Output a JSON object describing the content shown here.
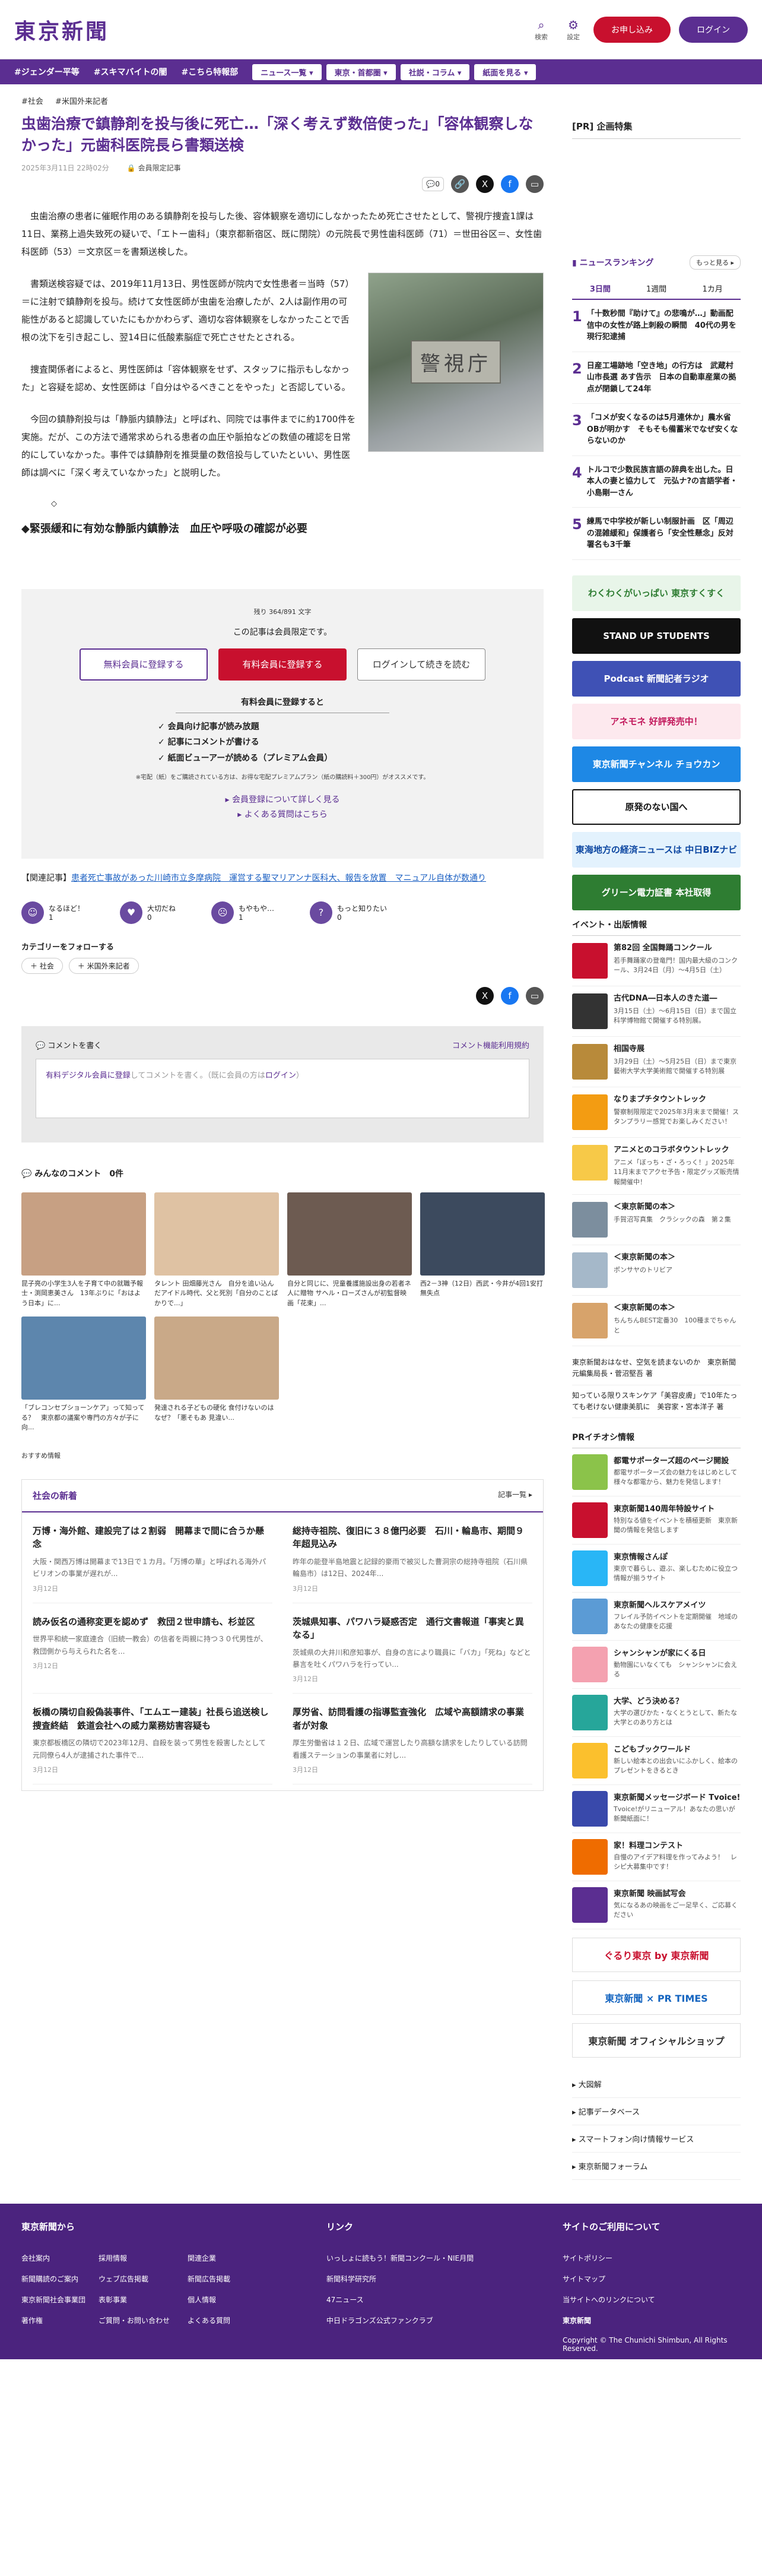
{
  "header": {
    "logo": "東京新聞",
    "search_label": "検索",
    "settings_label": "設定",
    "register_label": "お申し込み",
    "login_label": "ログイン"
  },
  "nav": {
    "hashtags": [
      "#ジェンダー平等",
      "#スキマバイトの闇",
      "#こちら特報部"
    ],
    "dropdowns": [
      "ニュース一覧",
      "東京・首都圏",
      "社説・コラム",
      "紙面を見る"
    ]
  },
  "article": {
    "tags": [
      "#社会",
      "#米国外来記者"
    ],
    "title": "虫歯治療で鎮静剤を投与後に死亡…「深く考えず数倍使った」「容体観察しなかった」元歯科医院長ら書類送検",
    "date": "2025年3月11日 22時02分",
    "member_only": "会員限定記事",
    "comment_count": "0",
    "paragraphs": [
      "虫歯治療の患者に催眠作用のある鎮静剤を投与した後、容体観察を適切にしなかったため死亡させたとして、警視庁捜査1課は11日、業務上過失致死の疑いで、「エトー歯科」（東京都新宿区、既に閉院）の元院長で男性歯科医師（71）＝世田谷区＝、女性歯科医師（53）＝文京区＝を書類送検した。",
      "書類送検容疑では、2019年11月13日、男性医師が院内で女性患者＝当時（57）＝に注射で鎮静剤を投与。続けて女性医師が虫歯を治療したが、2人は副作用の可能性があると認識していたにもかかわらず、適切な容体観察をしなかったことで舌根の沈下を引き起こし、翌14日に低酸素脳症で死亡させたとされる。",
      "捜査関係者によると、男性医師は「容体観察をせず、スタッフに指示もしなかった」と容疑を認め、女性医師は「自分はやるべきことをやった」と否認している。",
      "今回の鎮静剤投与は「静脈内鎮静法」と呼ばれ、同院では事件までに約1700件を実施。だが、この方法で通常求められる患者の血圧や脈拍などの数値の確認を日常的にしていなかった。事件では鎮静剤を推奨量の数倍投与していたといい、男性医師は調べに「深く考えていなかった」と説明した。"
    ],
    "image_sign": "警視庁",
    "diamond": "◇",
    "subheading": "◆緊張緩和に有効な静脈内鎮静法　血圧や呼吸の確認が必要"
  },
  "paywall": {
    "remaining": "残り 364/891 文字",
    "limit_text": "この記事は会員限定です。",
    "btn_free": "無料会員に登録する",
    "btn_paid": "有料会員に登録する",
    "btn_login": "ログインして続きを読む",
    "sub_heading": "有料会員に登録すると",
    "benefits": [
      "✓ 会員向け記事が読み放題",
      "✓ 記事にコメントが書ける",
      "✓ 紙面ビューアーが読める（プレミアム会員）"
    ],
    "note": "※宅配（紙）をご購読されている方は、お得な宅配プレミアムプラン（紙の購読料＋300円）がオススメです。",
    "link1": "▸ 会員登録について詳しく見る",
    "link2": "▸ よくある質問はこちら"
  },
  "related": {
    "label": "【関連記事】",
    "link": "患者死亡事故があった川崎市立多摩病院　運営する聖マリアンナ医科大、報告を放置　マニュアル自体が数通り"
  },
  "reactions": [
    {
      "label": "なるほど！",
      "count": "1"
    },
    {
      "label": "大切だね",
      "count": "0"
    },
    {
      "label": "もやもや…",
      "count": "1"
    },
    {
      "label": "もっと知りたい",
      "count": "0"
    }
  ],
  "follow": {
    "title": "カテゴリーをフォローする",
    "chips": [
      "＋ 社会",
      "＋ 米国外来記者"
    ]
  },
  "comment_box": {
    "title": "コメントを書く",
    "rules": "コメント機能利用規約",
    "placeholder_pre": "有料デジタル会員に登録",
    "placeholder_mid": "してコメントを書く。（既に会員の方は",
    "placeholder_login": "ログイン",
    "placeholder_post": "）"
  },
  "everyone_comments": {
    "title": "みんなのコメント",
    "count": "0件"
  },
  "thumbs": [
    {
      "caption": "昆子亮の小学生3人を子育て中の就職予報士・渕岡恵美さん　13年ぶりに「おはよう日本」に...",
      "color": "#c7a083"
    },
    {
      "caption": "タレント 田畑藤光さん　自分を追い込んだアイドル時代、父と死別「自分のことばかりで...」",
      "color": "#dfc2a3"
    },
    {
      "caption": "自分と同じに、児童養護施設出身の若者ネ人に贈物 サヘル・ローズさんが初監督映画「花束」...",
      "color": "#6d5b51"
    },
    {
      "caption": "西2－3神（12日）西武・今井が4回1安打無失点",
      "color": "#3c4a5e"
    },
    {
      "caption": "「ブレコンセプショーンケア」って知ってる？　東京都の議案や専門の方々が子に向...",
      "color": "#5d86ad"
    },
    {
      "caption": "発達される子どもの硬化 食付けないのはなぜ？「悪そもあ 見違い...",
      "color": "#c9a988"
    }
  ],
  "recommend_label": "おすすめ情報",
  "news_section": {
    "title": "社会の新着",
    "more": "記事一覧 ▸",
    "items": [
      {
        "title": "万博・海外館、建設完了は２割弱　開幕まで間に合うか懸念",
        "desc": "大阪・関西万博は開幕まで13日で１カ月。「万博の華」と呼ばれる海外パビリオンの事業が遅れが...",
        "date": "3月12日"
      },
      {
        "title": "総持寺祖院、復旧に３８億円必要　石川・輪島市、期間９年超見込み",
        "desc": "昨年の能登半島地震と記録的豪雨で被災した曹洞宗の総持寺祖院（石川県輪島市）は12日、2024年...",
        "date": "3月12日"
      },
      {
        "title": "読み仮名の通称変更を認めず　救団２世申請も、杉並区",
        "desc": "世界平和統一家庭連合（旧統一教会）の信者を両親に持つ３０代男性が、救団側から与えられた名を...",
        "date": "3月12日"
      },
      {
        "title": "茨城県知事、パワハラ疑惑否定　通行文書報道「事実と異なる」",
        "desc": "茨城県の大井川和彦知事が、自身の言により職員に「バカ」「死ね」などと暴言を吐くパワハラを行ってい...",
        "date": "3月12日"
      },
      {
        "title": "板橋の隣切自殺偽装事件、「エムエー建装」社長ら追送検し捜査終結　鉄道会社への威力業務妨害容疑も",
        "desc": "東京都板橋区の隣切で2023年12月、自殺を装って男性を殺害したとして元同僚ら4人が逮捕された事件で...",
        "date": "3月12日"
      },
      {
        "title": "厚労省、訪問看護の指導監査強化　広域や高額請求の事業者が対象",
        "desc": "厚生労働省は１２日、広域で運営したり高額な請求をしたりしている訪問看護ステーションの事業者に対し...",
        "date": "3月12日"
      }
    ]
  },
  "sidebar": {
    "pr_title": "[PR] 企画特集",
    "ranking_title": "ニュースランキング",
    "ranking_more": "もっと見る ▸",
    "ranking_tabs": [
      "3日間",
      "1週間",
      "1カ月"
    ],
    "ranking": [
      {
        "num": "1",
        "title": "「十数秒間『助けて』の悲鳴が…」動画配信中の女性が路上刺殺の瞬間　40代の男を現行犯逮捕"
      },
      {
        "num": "2",
        "title": "日産工場跡地「空き地」の行方は　武蔵村山市長選 あす告示　日本の自動車産業の拠点が閉鎖して24年"
      },
      {
        "num": "3",
        "title": "「コメが安くなるのは5月連休か」農水省OBが明かす　そもそも備蓄米でなぜ安くならないのか"
      },
      {
        "num": "4",
        "title": "トルコで少数民族言語の辞典を出した。日本人の妻と協力して　元弘ナ?の言語学者・小島剛一さん"
      },
      {
        "num": "5",
        "title": "練馬で中学校が新しい制服計画　区「周辺の混雑緩和」保護者ら「安全性懸念」反対署名も3千筆"
      }
    ],
    "banners": [
      {
        "label": "わくわくがいっぱい 東京すくすく",
        "bg": "#e8f5e9",
        "fg": "#2e7d32"
      },
      {
        "label": "STAND UP STUDENTS",
        "bg": "#111111",
        "fg": "#ffffff"
      },
      {
        "label": "Podcast 新聞記者ラジオ",
        "bg": "#3f51b5",
        "fg": "#ffffff"
      },
      {
        "label": "アネモネ 好評発売中！",
        "bg": "#fde9ee",
        "fg": "#c2185b"
      },
      {
        "label": "東京新聞チャンネル チョウカン",
        "bg": "#1e88e5",
        "fg": "#ffffff"
      },
      {
        "label": "原発のない国へ",
        "bg": "#ffffff",
        "fg": "#111111"
      },
      {
        "label": "東海地方の経済ニュースは 中日BIZナビ",
        "bg": "#e3f2fd",
        "fg": "#0d47a1"
      },
      {
        "label": "グリーン電力証書 本社取得",
        "bg": "#2e7d32",
        "fg": "#ffffff"
      }
    ],
    "events_title": "イベント・出版情報",
    "events": [
      {
        "title": "第82回 全国舞踊コンクール",
        "desc": "若手舞踊家の登竜門！国内最大級のコンクール、3月24日（月）〜4月5日（土）",
        "color": "#c8102e"
      },
      {
        "title": "古代DNA―日本人のきた道―",
        "desc": "3月15日（土）〜6月15日（日）まで国立科学博物館で開催する特別展。",
        "color": "#333333"
      },
      {
        "title": "相国寺展",
        "desc": "3月29日（土）〜5月25日（日）まで東京藝術大学大学美術館で開催する特別展",
        "color": "#b88a3a"
      },
      {
        "title": "なりまプチタウントレック",
        "desc": "警察制限限定で2025年3月末まで開催！スタンプラリー感覚でお楽しみください！",
        "color": "#f39c12"
      },
      {
        "title": "アニメとのコラボタウントレック",
        "desc": "アニメ「ぼっち・ざ・ろっく！」2025年11月末までアクセ予告・限定グッズ販売情報開催中！",
        "color": "#f7c948"
      },
      {
        "title": "＜東京新聞の本＞",
        "desc": "手賀沼写真集　クラシックの森　第２集",
        "color": "#7c8e9e"
      },
      {
        "title": "＜東京新聞の本＞",
        "desc": "ポンサヤのトリビア",
        "color": "#a5b8c9"
      },
      {
        "title": "＜東京新聞の本＞",
        "desc": "ちんちんBEST定番30　100種までちゃんと",
        "color": "#d7a36b"
      }
    ],
    "side_links": [
      "東京新聞おはなせ、空気を読まないのか　東京新聞元編集局長・菅沼堅吾 著",
      "知っている限りスキンケア「美容皮膚」で10年たっても老けない健康美肌に　美容家・宮本洋子 著"
    ],
    "pr_header": "PRイチオシ情報",
    "pr_items": [
      {
        "title": "都電サポーターズ超のページ開設",
        "desc": "都電サポーターズ会の魅力をはじめとして様々な都電から、魅力を発信します！",
        "color": "#8bc34a"
      },
      {
        "title": "東京新聞140周年特設サイト",
        "desc": "特別なる値をイベントを積極更新　東京新聞の情報を発信します",
        "color": "#c8102e"
      },
      {
        "title": "東京情報さんぽ",
        "desc": "東京で暮らし、遊ぶ、楽しむために役立つ情報が揃うサイト",
        "color": "#29b6f6"
      },
      {
        "title": "東京新聞ヘルスケアメイツ",
        "desc": "フレイル予防イベントを定期開催　地域のあなたの健康を応援",
        "color": "#5b9bd5"
      },
      {
        "title": "シャンシャンが家にくる日",
        "desc": "動物園にいなくても　シャンシャンに会える",
        "color": "#f4a1b0"
      },
      {
        "title": "大学、どう決める？",
        "desc": "大学の選びかた・なくとうとして、新たな大学とのあり方とは",
        "color": "#26a69a"
      },
      {
        "title": "こどもブックワールド",
        "desc": "新しい絵本との出会いにふかしく、絵本のプレゼントをきるとき",
        "color": "#fbc02d"
      },
      {
        "title": "東京新聞メッセージボード Tvoice!",
        "desc": "Tvoice!がリニューアル！あなたの思いが新聞紙面に！",
        "color": "#3949ab"
      },
      {
        "title": "家！料理コンテスト",
        "desc": "自慢のアイデア料理を作ってみよう！　レシピ大募集中です！",
        "color": "#ef6c00"
      },
      {
        "title": "東京新聞 映画試写会",
        "desc": "気になるあの映画をご一足早く、ご応募ください",
        "color": "#5b2e91"
      }
    ],
    "small_banners": [
      "ぐるり東京 by 東京新聞",
      "東京新聞 × PR TIMES",
      "東京新聞 オフィシャルショップ"
    ],
    "list": [
      "▸ 大図解",
      "▸ 記事データベース",
      "▸ スマートフォン向け情報サービス",
      "▸ 東京新聞フォーラム"
    ]
  },
  "footer": {
    "col1_title": "東京新聞から",
    "col1_items": [
      "会社案内",
      "採用情報",
      "関連企業",
      "新聞購読のご案内",
      "ウェブ広告掲載",
      "新聞広告掲載",
      "東京新聞社会事業団",
      "表彰事業",
      "個人情報",
      "著作権",
      "ご質問・お問い合わせ",
      "よくある質問"
    ],
    "col2_title": "リンク",
    "col2_items": [
      "いっしょに読もう！新聞コンクール・NIE月間",
      "新聞科学研究所",
      "47ニュース",
      "中日ドラゴンズ公式ファンクラブ"
    ],
    "col3_title": "サイトのご利用について",
    "col3_items": [
      "サイトポリシー",
      "サイトマップ",
      "当サイトへのリンクについて"
    ],
    "logo": "東京新聞",
    "copyright": "Copyright © The Chunichi Shimbun, All Rights Reserved."
  }
}
